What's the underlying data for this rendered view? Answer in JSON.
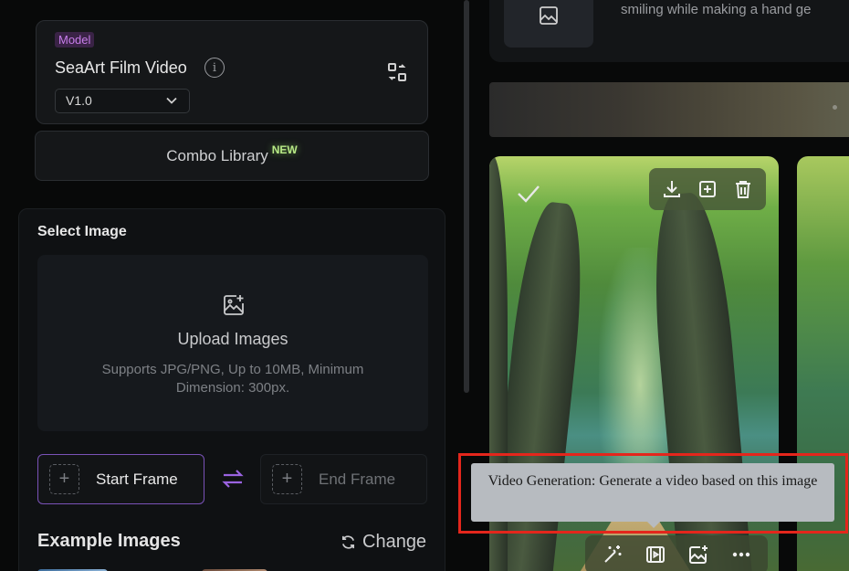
{
  "model": {
    "tag": "Model",
    "name": "SeaArt Film Video",
    "version": "V1.0"
  },
  "combo": {
    "label": "Combo Library",
    "badge": "NEW"
  },
  "select_image": {
    "title": "Select Image",
    "upload_title": "Upload Images",
    "upload_sub": "Supports JPG/PNG, Up to 10MB, Minimum Dimension: 300px.",
    "start_frame": "Start Frame",
    "end_frame": "End Frame",
    "plus": "+"
  },
  "examples": {
    "title": "Example Images",
    "change": "Change"
  },
  "prompt": {
    "text": "smiling while making a hand ge"
  },
  "tooltip": {
    "text": "Video Generation: Generate a video based on this image"
  },
  "colors": {
    "accent": "#7a52b8",
    "new_badge": "#b8e986",
    "highlight": "#e4261c"
  }
}
